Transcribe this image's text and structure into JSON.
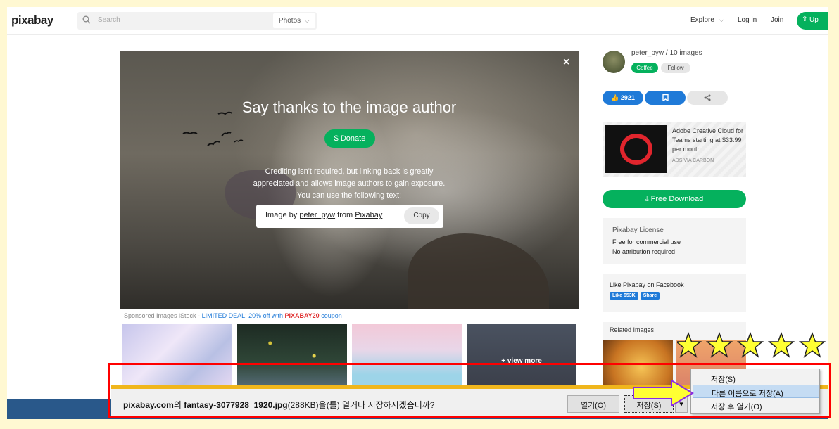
{
  "header": {
    "logo": "pixabay",
    "search_placeholder": "Search",
    "search_type": "Photos",
    "nav": [
      "Explore",
      "Log in",
      "Join"
    ],
    "upload_label": "Up"
  },
  "modal": {
    "title": "Say thanks to the image author",
    "donate_label": "$ Donate",
    "text": "Crediting isn't required, but linking back is greatly appreciated and allows image authors to gain exposure. You can use the following text:",
    "credit_prefix": "Image by",
    "credit_author": "peter_pyw",
    "credit_mid": "from",
    "credit_site": "Pixabay",
    "copy_label": "Copy",
    "close_label": "×"
  },
  "sponsored": {
    "prefix": "Sponsored Images iStock -",
    "deal": "LIMITED DEAL: 20% off with",
    "code": "PIXABAY20",
    "suffix": "coupon",
    "view_more": "+ view more"
  },
  "sidebar": {
    "author": "peter_pyw / 10 images",
    "coffee_label": "Coffee",
    "follow_label": "Follow",
    "likes": "2921",
    "ad_text": "Adobe Creative Cloud for Teams starting at $33.99 per month.",
    "ad_source": "ADS VIA CARBON",
    "free_download": "Free Download",
    "license_title": "Pixabay License",
    "license_line1": "Free for commercial use",
    "license_line2": "No attribution required",
    "fb_title": "Like Pixabay on Facebook",
    "fb_like": "Like 653K",
    "fb_share": "Share",
    "related_title": "Related Images"
  },
  "download_bar": {
    "site": "pixabay.com",
    "msg_part1": "의",
    "filename": "fantasy-3077928_1920.jpg",
    "msg_part2": "(288KB)을(를) 열거나 저장하시겠습니까?",
    "open_label": "열기(O)",
    "save_label": "저장(S)",
    "dropdown_label": "▾"
  },
  "context_menu": {
    "items": [
      "저장(S)",
      "다른 이름으로 저장(A)",
      "저장 후 열기(O)"
    ],
    "selected_index": 1
  },
  "colors": {
    "brand_green": "#05b15d",
    "link_blue": "#1f7ad8",
    "highlight_red": "#ff0000",
    "star_yellow": "#ffff33"
  }
}
